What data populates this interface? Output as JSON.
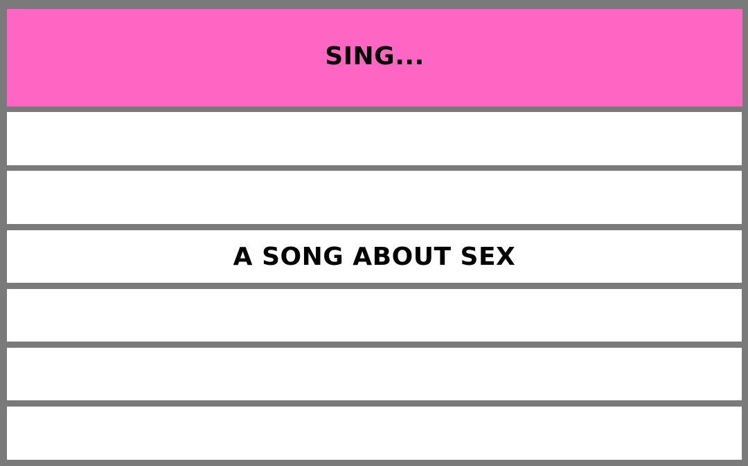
{
  "board": {
    "title": "SING...",
    "rows": [
      {
        "text": ""
      },
      {
        "text": ""
      },
      {
        "text": "A SONG ABOUT SEX"
      },
      {
        "text": ""
      },
      {
        "text": ""
      },
      {
        "text": ""
      }
    ]
  },
  "colors": {
    "header_bg": "#ff66c4",
    "frame": "#7a7a7a",
    "row_bg": "#ffffff",
    "text": "#000000"
  }
}
